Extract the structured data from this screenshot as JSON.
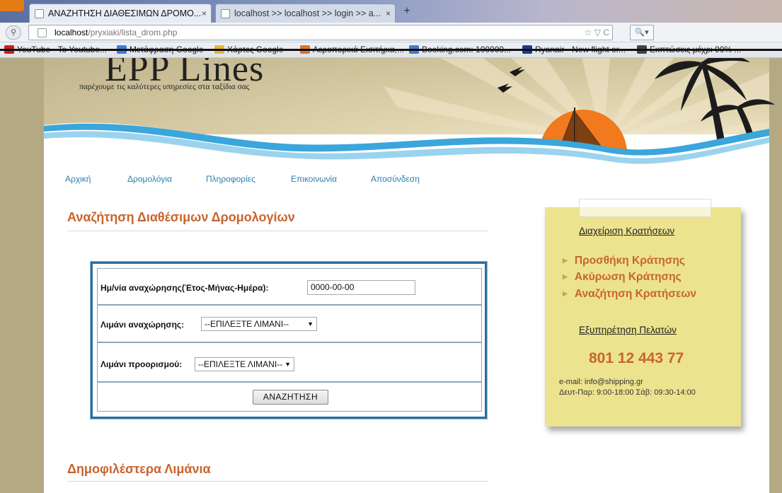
{
  "browser": {
    "tabs": [
      {
        "label": "ΑΝΑΖΗΤΗΣΗ ΔΙΑΘΕΣΙΜΩΝ ΔΡΟΜΟ...",
        "close": "×",
        "active": true
      },
      {
        "label": "localhost >> localhost >> login >> a...",
        "close": "×",
        "active": false
      }
    ],
    "new_tab": "+",
    "url_host": "localhost",
    "url_path": "/pryxiaki/lista_drom.php",
    "url_icons": "☆ ▽ C",
    "bookmarks": [
      {
        "label": "YouTube - To Youtube...",
        "icon_color": "#cc1f1f"
      },
      {
        "label": "Μετάφραση Google",
        "icon_color": "#3c7be0"
      },
      {
        "label": "Χάρτες Google",
        "icon_color": "#e8b53a"
      },
      {
        "label": "Αεροπορικά Εισιτήρια,...",
        "icon_color": "#d8762a"
      },
      {
        "label": "Booking.com: 100000...",
        "icon_color": "#4a78c9"
      },
      {
        "label": "Ryanair - New flight or...",
        "icon_color": "#1d3b8a"
      },
      {
        "label": "Εκπτώσεις μέχρι 90% ...",
        "icon_color": "#444444"
      }
    ]
  },
  "site": {
    "logo": "EPP Lines",
    "tagline": "παρέχουμε τις καλύτερες υπηρεσίες στα ταξίδια σας",
    "nav": [
      "Αρχική",
      "Δρομολόγια",
      "Πληροφορίες",
      "Επικοινωνία",
      "Αποσύνδεση"
    ]
  },
  "search": {
    "heading": "Αναζήτηση Διαθέσιμων Δρομολογίων",
    "date_label": "Ημ/νία αναχώρησης(Έτος-Μήνας-Ημέρα):",
    "date_value": "0000-00-00",
    "departure_label": "Λιμάνι αναχώρησης:",
    "departure_selected": "--ΕΠΙΛΕΞΤΕ ΛΙΜΑΝΙ--",
    "destination_label": "Λιμάνι προορισμού:",
    "destination_selected": "--ΕΠΙΛΕΞΤΕ ΛΙΜΑΝΙ--",
    "button": "ΑΝΑΖΗΤΗΣΗ"
  },
  "popular": {
    "heading": "Δημοφιλέστερα Λιμάνια"
  },
  "sidebar": {
    "reservations_title": "Διαχείριση Κρατήσεων",
    "items": [
      "Προσθήκη Κράτησης",
      "Ακύρωση Κράτησης",
      "Αναζήτηση Κρατήσεων"
    ],
    "support_title": "Εξυπηρέτηση Πελατών",
    "phone": "801 12 443 77",
    "email": "e-mail: info@shipping.gr",
    "hours": "Δευτ-Παρ: 9:00-18:00 Σάβ: 09:30-14:00"
  },
  "colors": {
    "accent": "#c8642d",
    "link": "#2d7fb0",
    "note": "#ece38e",
    "sun": "#f07a1d",
    "sea": "#3aa6dc"
  }
}
